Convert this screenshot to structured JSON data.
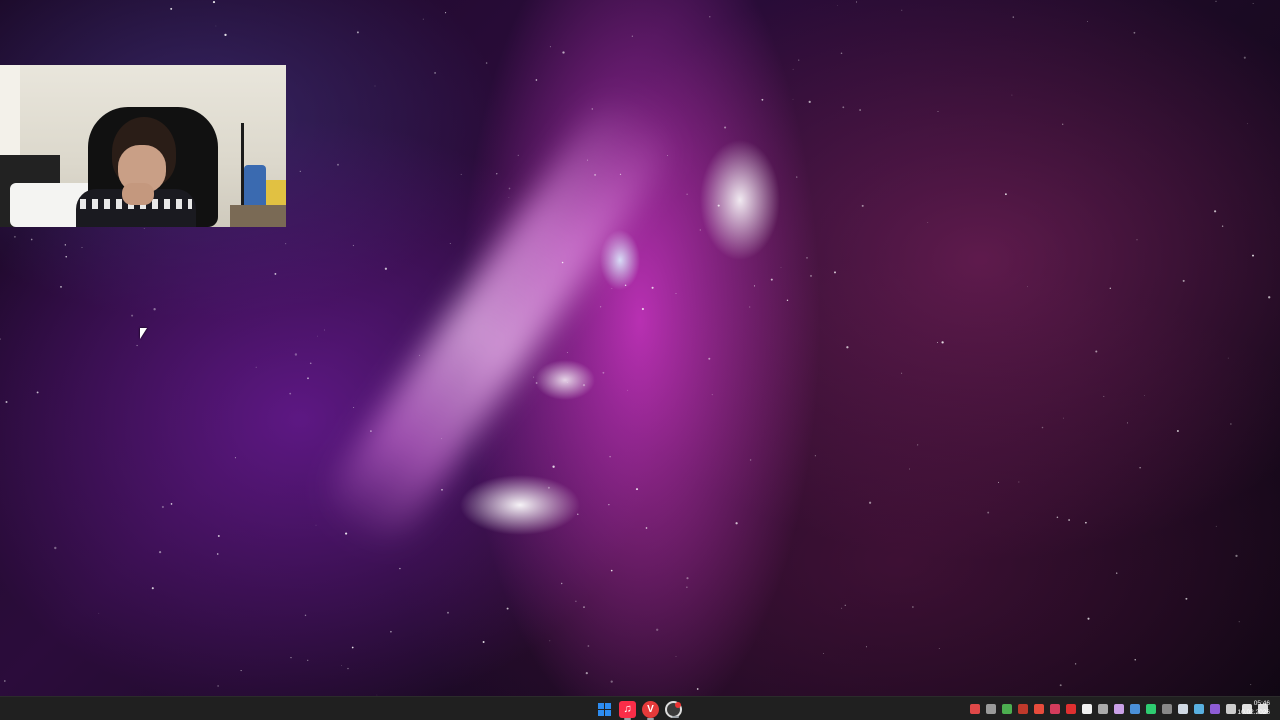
{
  "desktop": {
    "wallpaper": "purple-pink cosmic nebula",
    "accent_colors": [
      "#ff66ff",
      "#7a1fb5",
      "#b0306e"
    ]
  },
  "webcam": {
    "description_icon": "webcam-feed"
  },
  "taskbar": {
    "pinned_apps": [
      {
        "name": "start-button",
        "icon": "windows-logo-icon",
        "active": false
      },
      {
        "name": "apple-music",
        "icon": "music-note-icon",
        "active": true
      },
      {
        "name": "vivaldi",
        "icon": "vivaldi-browser-icon",
        "active": true
      },
      {
        "name": "obs-studio",
        "icon": "obs-record-icon",
        "active": true
      }
    ],
    "tray_icons": [
      {
        "icon": "record-icon",
        "color": "#e04848"
      },
      {
        "icon": "app-tray-icon-1",
        "color": "#9a9a9a"
      },
      {
        "icon": "app-tray-icon-2",
        "color": "#4caf50"
      },
      {
        "icon": "app-tray-icon-3",
        "color": "#c0392b"
      },
      {
        "icon": "app-tray-icon-4",
        "color": "#e74c3c"
      },
      {
        "icon": "microphone-icon",
        "color": "#d43c5c"
      },
      {
        "icon": "app-tray-icon-5",
        "color": "#e03030"
      },
      {
        "icon": "app-tray-icon-6",
        "color": "#f0f0f0"
      },
      {
        "icon": "app-tray-icon-7",
        "color": "#aaaaaa"
      },
      {
        "icon": "app-tray-icon-8",
        "color": "#c9a0e6"
      },
      {
        "icon": "app-tray-icon-9",
        "color": "#4a90d9"
      },
      {
        "icon": "app-tray-icon-10",
        "color": "#2ecc71"
      },
      {
        "icon": "app-tray-icon-11",
        "color": "#888888"
      },
      {
        "icon": "steam-icon",
        "color": "#cfd8e3"
      },
      {
        "icon": "app-tray-icon-12",
        "color": "#59b0e0"
      },
      {
        "icon": "app-tray-icon-13",
        "color": "#8e5cd6"
      },
      {
        "icon": "app-tray-icon-14",
        "color": "#cccccc"
      },
      {
        "icon": "network-icon",
        "color": "#e0e0e0"
      },
      {
        "icon": "volume-icon",
        "color": "#e0e0e0"
      }
    ],
    "clock": {
      "time": "05:46",
      "date": "10.02.2026"
    }
  }
}
